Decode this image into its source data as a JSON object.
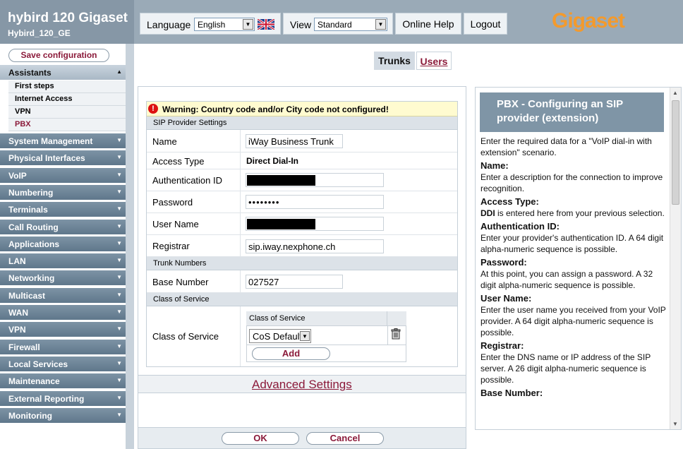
{
  "header": {
    "product_title": "hybird 120 Gigaset",
    "device_name": "Hybird_120_GE",
    "language_label": "Language",
    "language_value": "English",
    "view_label": "View",
    "view_value": "Standard",
    "online_help": "Online Help",
    "logout": "Logout",
    "logo": "Gigaset",
    "logo_color": "#f39a2d"
  },
  "sidebar": {
    "save_configuration": "Save configuration",
    "sections": [
      {
        "label": "Assistants",
        "expanded": true
      },
      {
        "label": "System Management"
      },
      {
        "label": "Physical Interfaces"
      },
      {
        "label": "VoIP"
      },
      {
        "label": "Numbering"
      },
      {
        "label": "Terminals"
      },
      {
        "label": "Call Routing"
      },
      {
        "label": "Applications"
      },
      {
        "label": "LAN"
      },
      {
        "label": "Networking"
      },
      {
        "label": "Multicast"
      },
      {
        "label": "WAN"
      },
      {
        "label": "VPN"
      },
      {
        "label": "Firewall"
      },
      {
        "label": "Local Services"
      },
      {
        "label": "Maintenance"
      },
      {
        "label": "External Reporting"
      },
      {
        "label": "Monitoring"
      }
    ],
    "assistant_items": [
      {
        "label": "First steps"
      },
      {
        "label": "Internet Access"
      },
      {
        "label": "VPN"
      },
      {
        "label": "PBX",
        "active": true
      }
    ]
  },
  "tabs": {
    "trunks": "Trunks",
    "users": "Users"
  },
  "form": {
    "warning": "Warning: Country code and/or City code not configured!",
    "section_sip": "SIP Provider Settings",
    "name_label": "Name",
    "name_value": "iWay Business Trunk",
    "access_type_label": "Access Type",
    "access_type_value": "Direct Dial-In",
    "auth_id_label": "Authentication ID",
    "password_label": "Password",
    "password_value": "••••••••",
    "user_name_label": "User Name",
    "registrar_label": "Registrar",
    "registrar_value": "sip.iway.nexphone.ch",
    "section_trunk_numbers": "Trunk Numbers",
    "base_number_label": "Base Number",
    "base_number_value": "027527",
    "section_cos": "Class of Service",
    "cos_label": "Class of Service",
    "cos_column_header": "Class of Service",
    "cos_value": "CoS Default",
    "add_button": "Add",
    "advanced_settings": "Advanced Settings",
    "ok": "OK",
    "cancel": "Cancel"
  },
  "help": {
    "title": "PBX - Configuring an SIP provider (extension)",
    "intro": "Enter the required data for a \"VoIP dial-in with extension\" scenario.",
    "entries": [
      {
        "term": "Name",
        "text": "Enter a description for the connection to improve recognition."
      },
      {
        "term": "Access Type",
        "text_bold": "DDI",
        "text": " is entered here from your previous selection."
      },
      {
        "term": "Authentication ID",
        "text": "Enter your provider's authentication ID. A 64 digit alpha-numeric sequence is possible."
      },
      {
        "term": "Password",
        "text": "At this point, you can assign a password. A 32 digit alpha-numeric sequence is possible."
      },
      {
        "term": "User Name",
        "text": "Enter the user name you received from your VoIP provider. A 64 digit alpha-numeric sequence is possible."
      },
      {
        "term": "Registrar",
        "text": "Enter the DNS name or IP address of the SIP server. A 26 digit alpha-numeric sequence is possible."
      },
      {
        "term": "Base Number",
        "text": ""
      }
    ]
  }
}
